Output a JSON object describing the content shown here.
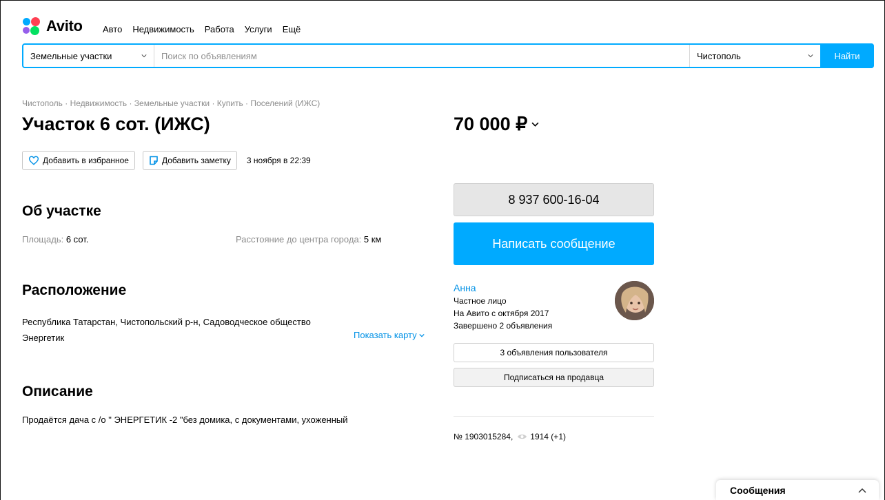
{
  "header": {
    "logo_text": "Avito",
    "nav": [
      "Авто",
      "Недвижимость",
      "Работа",
      "Услуги",
      "Ещё"
    ]
  },
  "search": {
    "category": "Земельные участки",
    "placeholder": "Поиск по объявлениям",
    "city": "Чистополь",
    "button": "Найти"
  },
  "breadcrumb": "Чистополь · Недвижимость · Земельные участки · Купить · Поселений (ИЖС)",
  "listing": {
    "title": "Участок 6 сот. (ИЖС)",
    "price": "70 000 ₽",
    "favorite_label": "Добавить в избранное",
    "note_label": "Добавить заметку",
    "date": "3 ноября в 22:39"
  },
  "about": {
    "heading": "Об участке",
    "area_label": "Площадь:",
    "area_value": "6 сот.",
    "distance_label": "Расстояние до центра города:",
    "distance_value": "5 км"
  },
  "location": {
    "heading": "Расположение",
    "address": "Республика Татарстан, Чистопольский р-н, Садоводческое общество Энергетик",
    "show_map": "Показать карту"
  },
  "description": {
    "heading": "Описание",
    "text": "Продаётся дача с /о \" ЭНЕРГЕТИК -2 \"без домика, с документами, ухоженный"
  },
  "contact": {
    "phone": "8 937 600-16-04",
    "write_button": "Написать сообщение"
  },
  "seller": {
    "name": "Анна",
    "type": "Частное лицо",
    "since": "На Авито с октября 2017",
    "completed": "Завершено 2 объявления",
    "listings_button": "3 объявления пользователя",
    "subscribe_button": "Подписаться на продавца"
  },
  "meta": {
    "id": "№ 1903015284,",
    "views": "1914 (+1)"
  },
  "messages": {
    "label": "Сообщения"
  },
  "colors": {
    "accent": "#00aaff",
    "link": "#0091e6"
  }
}
